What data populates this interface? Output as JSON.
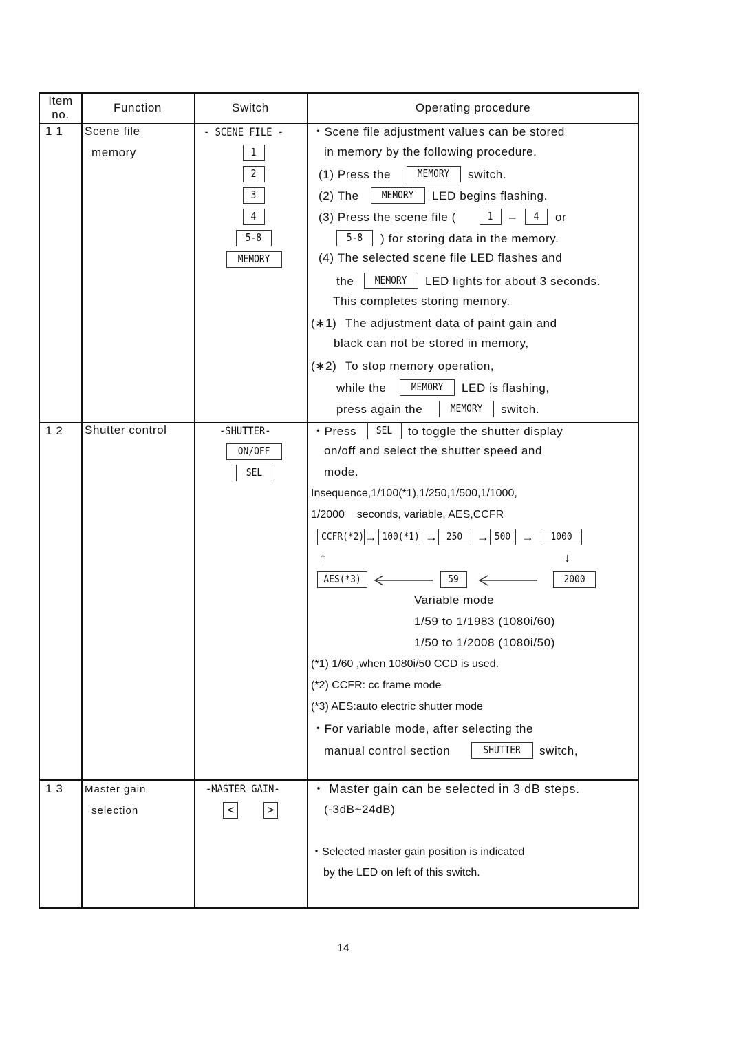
{
  "header": {
    "item_no": [
      "Item",
      "no."
    ],
    "function": "Function",
    "switch": "Switch",
    "procedure": "Operating procedure"
  },
  "rows": [
    {
      "item_no": "1 1",
      "function": [
        "Scene file",
        "memory"
      ],
      "switch_title": "- SCENE FILE -",
      "switch_keys": [
        "1",
        "2",
        "3",
        "4",
        "5-8",
        "MEMORY"
      ],
      "procedure": {
        "intro": [
          "・Scene file adjustment values can be stored",
          "in memory by the following procedure."
        ],
        "step1": {
          "pre": "(1) Press the",
          "key": "MEMORY",
          "post": "switch."
        },
        "step2": {
          "pre": "(2) The",
          "key": "MEMORY",
          "post": "LED begins flashing."
        },
        "step3": {
          "pre": "(3) Press the scene file (",
          "key1": "1",
          "dash": "–",
          "key2": "4",
          "post": "or",
          "key3": "5-8",
          "post2": ") for storing data in the memory."
        },
        "step4": {
          "line1": "(4) The selected scene file LED flashes and",
          "pre": "the",
          "key": "MEMORY",
          "post": "LED lights for about 3 seconds.",
          "line3": "This completes storing memory."
        },
        "note1": {
          "mark": "(∗1)",
          "line1": "The adjustment data of paint gain and",
          "line2": "black can not be stored in memory,"
        },
        "note2": {
          "mark": "(∗2)",
          "line1": "To stop memory operation,",
          "pre2": "while the",
          "key2": "MEMORY",
          "post2": "LED is flashing,",
          "pre3": "press again the",
          "key3": "MEMORY",
          "post3": "switch."
        }
      }
    },
    {
      "item_no": "1 2",
      "function": [
        "Shutter control"
      ],
      "switch_title": "-SHUTTER-",
      "switch_keys": [
        "ON/OFF",
        "SEL"
      ],
      "procedure": {
        "line1": {
          "pre": "・Press",
          "key": "SEL",
          "post": "to toggle the shutter display"
        },
        "line2": "on/off and select the shutter speed and",
        "line3": "mode.",
        "sequence_text": [
          "Insequence,1/100(*1),1/250,1/500,1/1000,",
          "1/2000    seconds, variable, AES,CCFR"
        ],
        "flow": {
          "top": [
            "CCFR(*2)",
            "100(*1)",
            "250",
            "500",
            "1000"
          ],
          "bottom": [
            "AES(*3)",
            "59",
            "2000"
          ],
          "arrow_right": "→",
          "arrow_up": "↑",
          "arrow_down": "↓"
        },
        "variable": [
          "Variable mode",
          "1/59 to 1/1983 (1080i/60)",
          "1/50 to 1/2008 (1080i/50)"
        ],
        "footnotes": [
          "(*1) 1/60 ,when 1080i/50 CCD is used.",
          "(*2) CCFR: cc frame mode",
          "(*3) AES:auto electric shutter mode"
        ],
        "variable_note": {
          "line1": "・For variable mode, after selecting the",
          "pre": "manual control section",
          "key": "SHUTTER",
          "post": "switch,"
        }
      }
    },
    {
      "item_no": "1 3",
      "function": [
        "Master gain",
        "selection"
      ],
      "switch_title": "-MASTER GAIN-",
      "switch_keys": [
        "<",
        ">"
      ],
      "procedure": {
        "line1": "・ Master gain can be selected in 3 dB steps.",
        "line2": "(-3dB~24dB)",
        "line3": "・Selected master gain position is indicated",
        "line4": "by the LED on left of this switch."
      }
    }
  ],
  "page_number": "14"
}
